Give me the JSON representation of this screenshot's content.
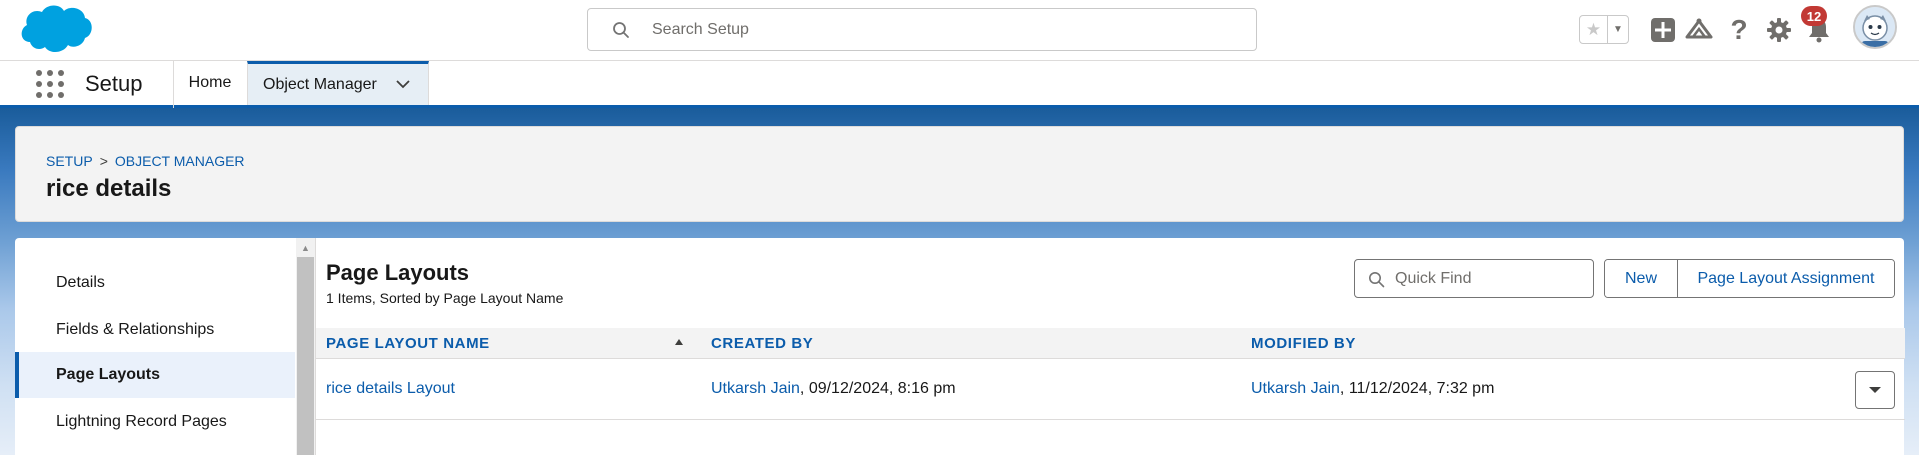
{
  "header": {
    "logo": "salesforce-cloud-logo",
    "search_placeholder": "Search Setup",
    "notification_count": "12",
    "icons": [
      "star-icon",
      "chevron-down-icon",
      "plus-icon",
      "trailhead-icon",
      "help-icon",
      "gear-icon",
      "bell-icon",
      "avatar"
    ]
  },
  "nav": {
    "app_name": "Setup",
    "tabs": [
      {
        "label": "Home"
      },
      {
        "label": "Object Manager"
      }
    ]
  },
  "page": {
    "breadcrumb": [
      "SETUP",
      ">",
      "OBJECT MANAGER"
    ],
    "title": "rice details"
  },
  "sidebar": {
    "items": [
      {
        "label": "Details"
      },
      {
        "label": "Fields & Relationships"
      },
      {
        "label": "Page Layouts",
        "active": true
      },
      {
        "label": "Lightning Record Pages"
      }
    ]
  },
  "main": {
    "title": "Page Layouts",
    "subtitle": "1 Items, Sorted by Page Layout Name",
    "quick_find_placeholder": "Quick Find",
    "new_label": "New",
    "assignment_label": "Page Layout Assignment",
    "columns": [
      "PAGE LAYOUT NAME",
      "CREATED BY",
      "MODIFIED BY"
    ],
    "rows": [
      {
        "name": "rice details Layout",
        "created_by": "Utkarsh Jain",
        "created_date": ", 09/12/2024, 8:16 pm",
        "modified_by": "Utkarsh Jain",
        "modified_date": ", 11/12/2024, 7:32 pm"
      }
    ]
  },
  "colors": {
    "brand_blue": "#0b5cab",
    "logo_blue": "#00a1e0",
    "badge_red": "#c23934"
  }
}
